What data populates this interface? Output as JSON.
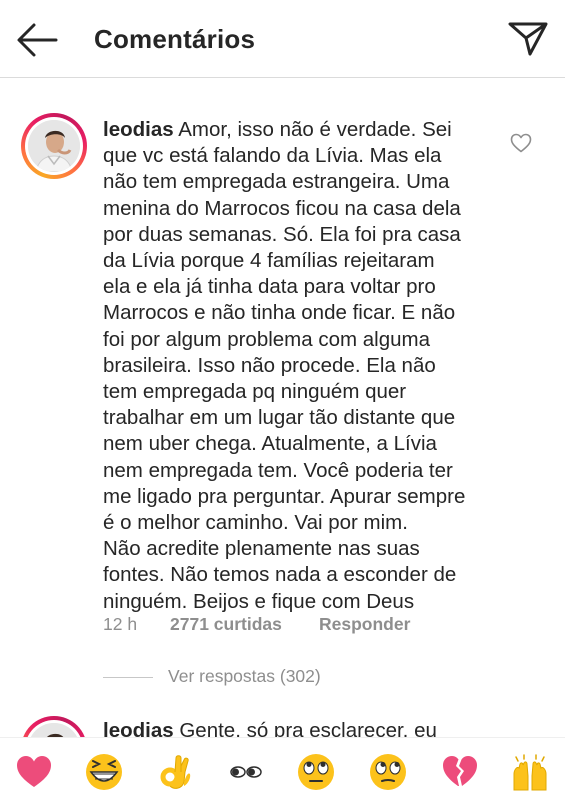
{
  "header": {
    "title": "Comentários",
    "back_icon": "arrow-left-icon",
    "send_icon": "paper-plane-icon"
  },
  "comment": {
    "username": "leodias",
    "lines": [
      "Amor, isso não é verdade. Sei",
      "que vc está falando da Lívia. Mas ela",
      "não tem empregada estrangeira. Uma",
      "menina do Marrocos ficou na casa dela",
      "por duas semanas. Só. Ela foi pra casa",
      "da Lívia porque 4 famílias rejeitaram",
      "ela e ela já tinha data para voltar pro",
      "Marrocos e não tinha onde ficar. E não",
      "foi por algum problema com alguma",
      "brasileira. Isso não procede. Ela não",
      "tem empregada pq ninguém quer",
      "trabalhar em um lugar tão distante que",
      "nem uber chega. Atualmente, a Lívia",
      "nem empregada tem. Você poderia ter",
      "me ligado pra perguntar. Apurar sempre",
      "é o melhor caminho. Vai por mim.",
      "Não acredite plenamente nas suas",
      "fontes. Não temos nada a esconder de",
      "ninguém. Beijos e fique com Deus"
    ],
    "time": "12 h",
    "likes": "2771 curtidas",
    "reply_label": "Responder",
    "view_replies": "Ver respostas (302)",
    "like_icon": "heart-outline-icon"
  },
  "comment2": {
    "username": "leodias",
    "text": "Gente, só pra esclarecer, eu"
  },
  "emoji_bar": {
    "items": [
      "heart-emoji",
      "grinning-squint-emoji",
      "ok-hand-emoji",
      "eyes-emoji",
      "face-with-rolling-eyes-emoji",
      "face-with-rolling-eyes-emoji",
      "broken-heart-emoji",
      "raising-hands-emoji"
    ]
  },
  "colors": {
    "text": "#262626",
    "secondary": "#8e8e8e",
    "heart": "#ed4c7b",
    "emoji_yellow": "#fcc21b"
  }
}
